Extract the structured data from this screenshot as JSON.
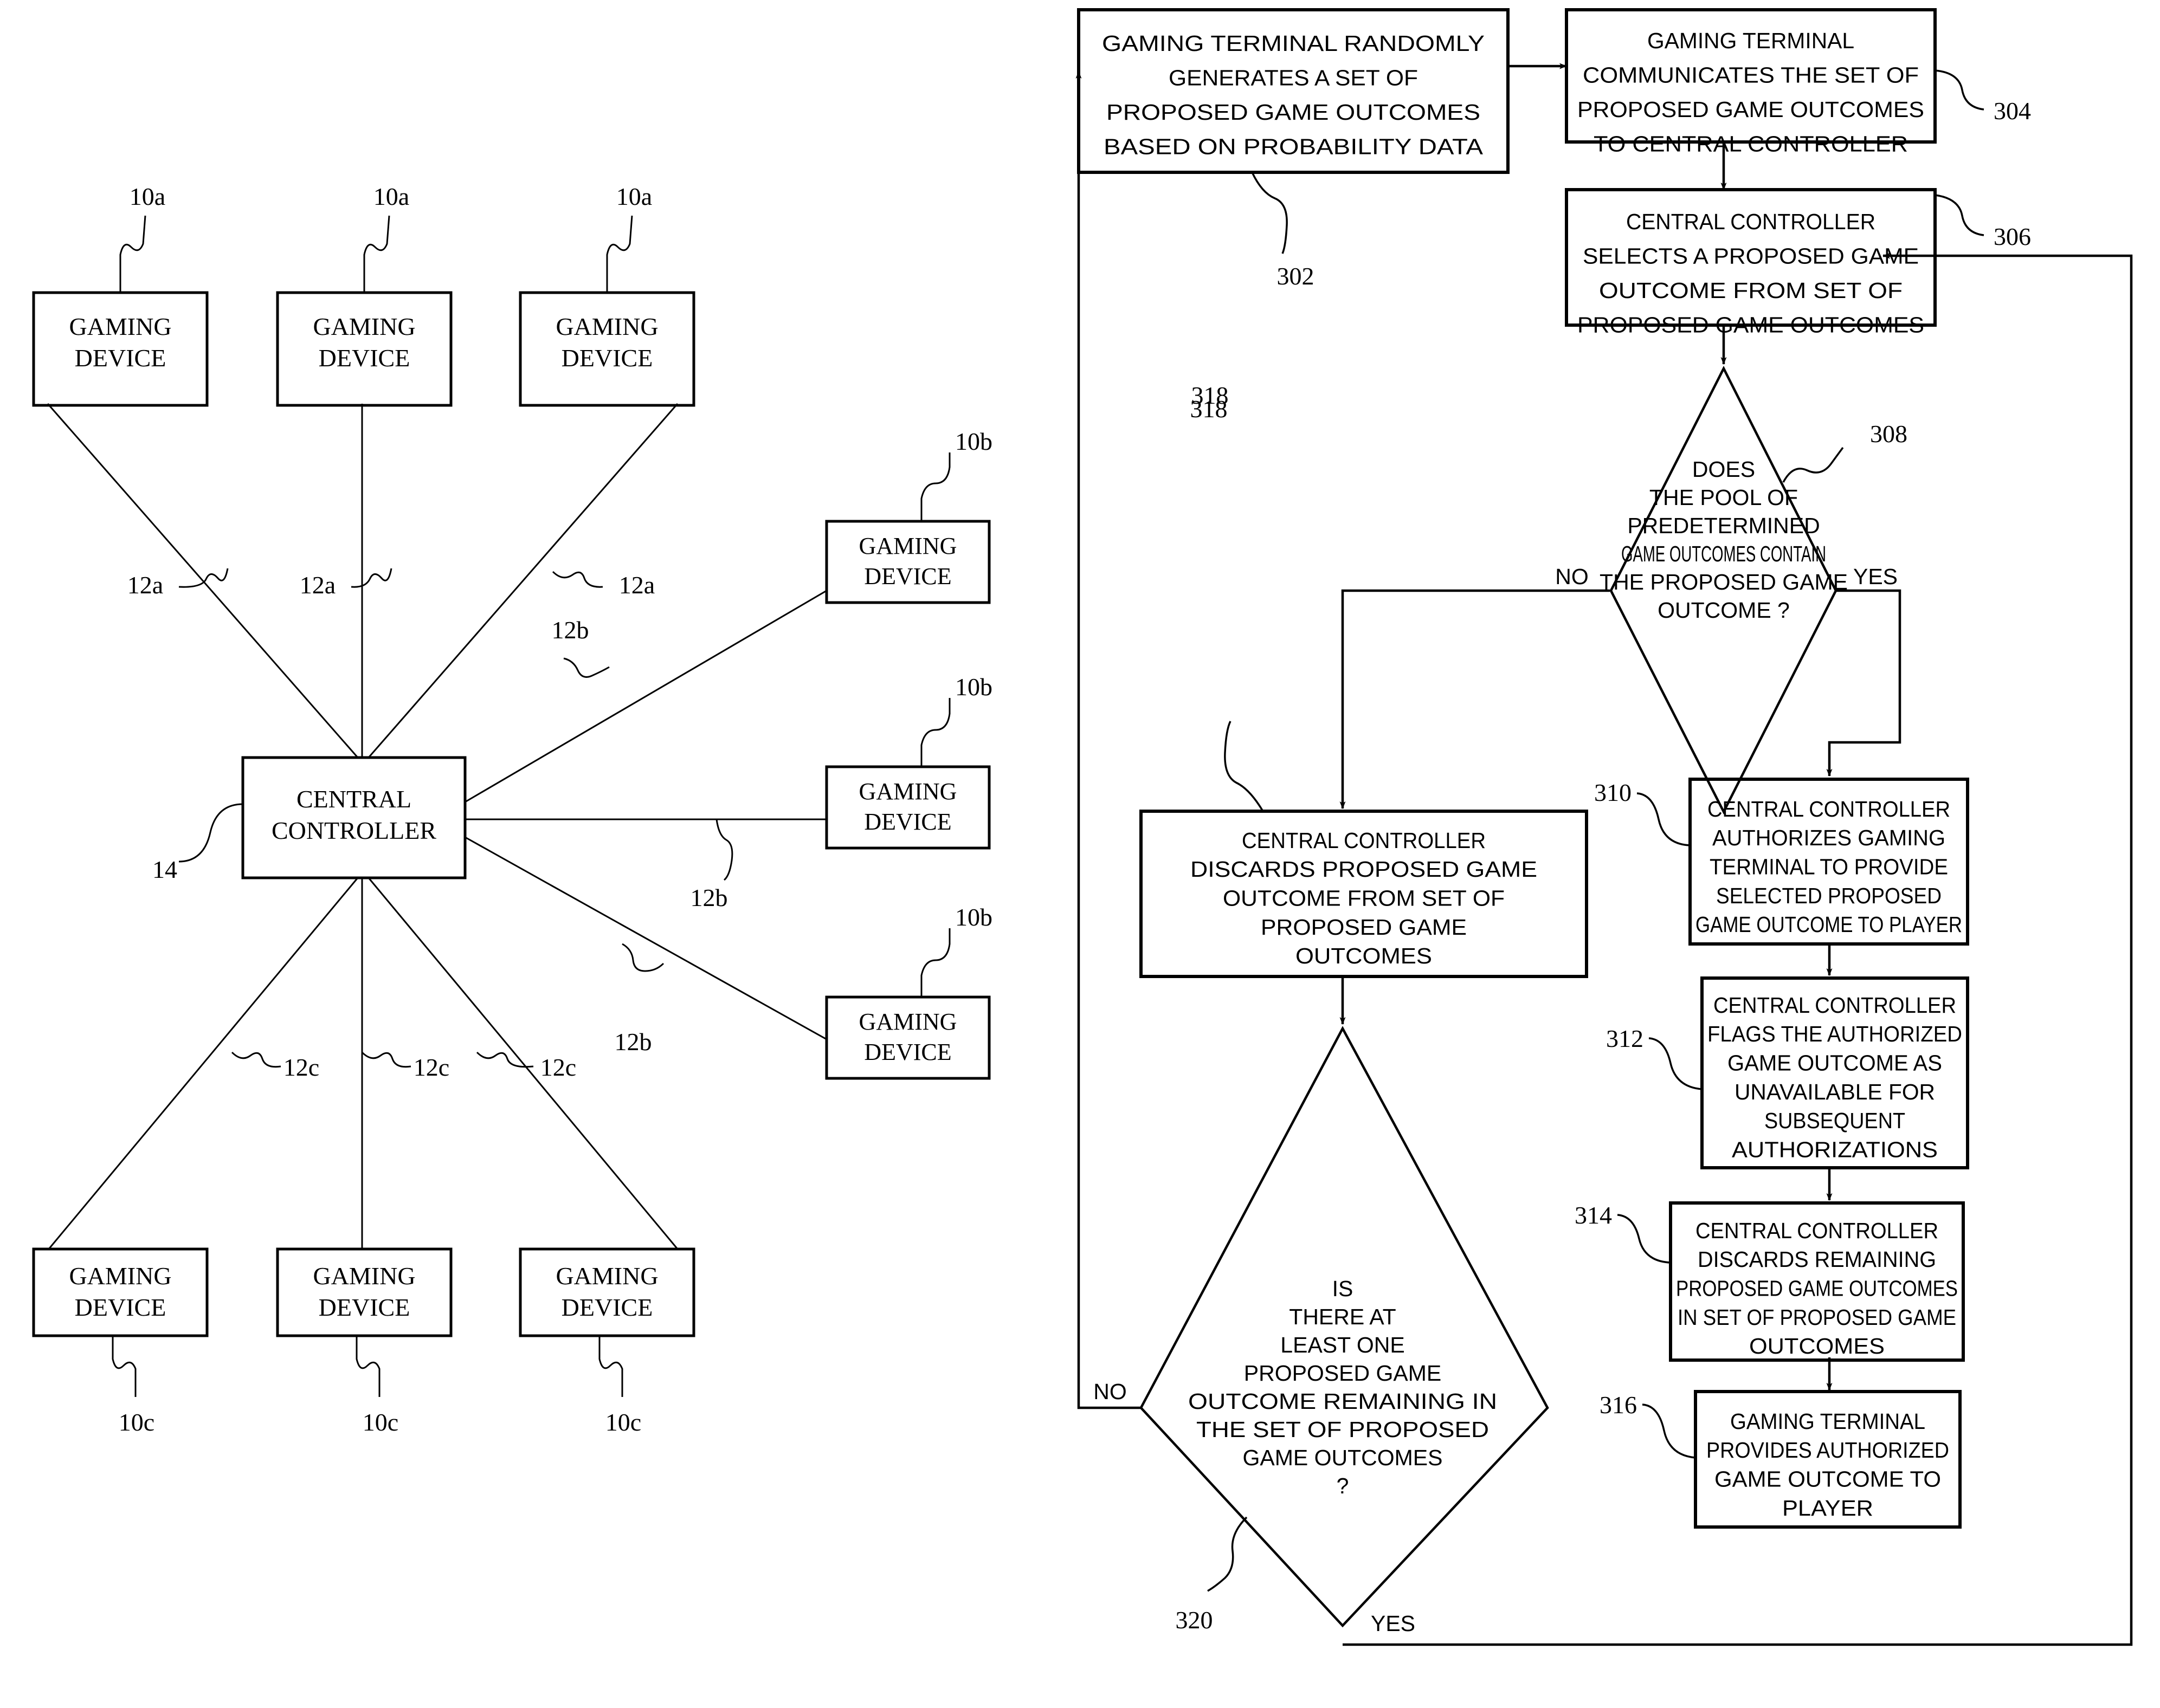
{
  "figure_left": {
    "name": "network-topology-diagram",
    "central": {
      "label_line1": "CENTRAL",
      "label_line2": "CONTROLLER",
      "ref": "14"
    },
    "device_label_line1": "GAMING",
    "device_label_line2": "DEVICE",
    "top_devices": [
      {
        "ref": "10a",
        "link_ref": "12a"
      },
      {
        "ref": "10a",
        "link_ref": "12a"
      },
      {
        "ref": "10a",
        "link_ref": "12a"
      }
    ],
    "right_devices": [
      {
        "ref": "10b",
        "link_ref": "12b"
      },
      {
        "ref": "10b",
        "link_ref": "12b"
      },
      {
        "ref": "10b",
        "link_ref": "12b"
      }
    ],
    "bottom_devices": [
      {
        "ref": "10c",
        "link_ref": "12c"
      },
      {
        "ref": "10c",
        "link_ref": "12c"
      },
      {
        "ref": "10c",
        "link_ref": "12c"
      }
    ]
  },
  "figure_right": {
    "name": "game-outcome-authorization-flowchart",
    "nodes": {
      "n302": {
        "ref": "302",
        "shape": "process",
        "lines": [
          "GAMING TERMINAL RANDOMLY",
          "GENERATES A SET OF",
          "PROPOSED GAME OUTCOMES",
          "BASED ON PROBABILITY DATA"
        ]
      },
      "n304": {
        "ref": "304",
        "shape": "process",
        "lines": [
          "GAMING TERMINAL",
          "COMMUNICATES THE SET OF",
          "PROPOSED GAME OUTCOMES",
          "TO CENTRAL CONTROLLER"
        ]
      },
      "n306": {
        "ref": "306",
        "shape": "process",
        "lines": [
          "CENTRAL CONTROLLER",
          "SELECTS A PROPOSED GAME",
          "OUTCOME FROM SET OF",
          "PROPOSED GAME OUTCOMES"
        ]
      },
      "n308": {
        "ref": "308",
        "shape": "decision",
        "lines": [
          "DOES",
          "THE POOL OF",
          "PREDETERMINED",
          "GAME OUTCOMES CONTAIN",
          "THE PROPOSED GAME",
          "OUTCOME ?"
        ],
        "branch_no": "NO",
        "branch_yes": "YES"
      },
      "n310": {
        "ref": "310",
        "shape": "process",
        "lines": [
          "CENTRAL CONTROLLER",
          "AUTHORIZES GAMING",
          "TERMINAL TO PROVIDE",
          "SELECTED PROPOSED",
          "GAME OUTCOME TO PLAYER"
        ]
      },
      "n312": {
        "ref": "312",
        "shape": "process",
        "lines": [
          "CENTRAL CONTROLLER",
          "FLAGS THE AUTHORIZED",
          "GAME OUTCOME AS",
          "UNAVAILABLE FOR",
          "SUBSEQUENT",
          "AUTHORIZATIONS"
        ]
      },
      "n314": {
        "ref": "314",
        "shape": "process",
        "lines": [
          "CENTRAL CONTROLLER",
          "DISCARDS REMAINING",
          "PROPOSED GAME OUTCOMES",
          "IN SET OF PROPOSED GAME",
          "OUTCOMES"
        ]
      },
      "n316": {
        "ref": "316",
        "shape": "process",
        "lines": [
          "GAMING TERMINAL",
          "PROVIDES AUTHORIZED",
          "GAME OUTCOME TO",
          "PLAYER"
        ]
      },
      "n318": {
        "ref": "318",
        "shape": "process",
        "lines": [
          "CENTRAL CONTROLLER",
          "DISCARDS PROPOSED GAME",
          "OUTCOME FROM SET OF",
          "PROPOSED GAME",
          "OUTCOMES"
        ]
      },
      "n320": {
        "ref": "320",
        "shape": "decision",
        "lines": [
          "IS",
          "THERE AT",
          "LEAST ONE",
          "PROPOSED GAME",
          "OUTCOME REMAINING IN",
          "THE SET OF PROPOSED",
          "GAME OUTCOMES",
          "?"
        ],
        "branch_no": "NO",
        "branch_yes": "YES"
      }
    }
  },
  "colors": {
    "ink": "#000000",
    "paper": "#ffffff"
  }
}
